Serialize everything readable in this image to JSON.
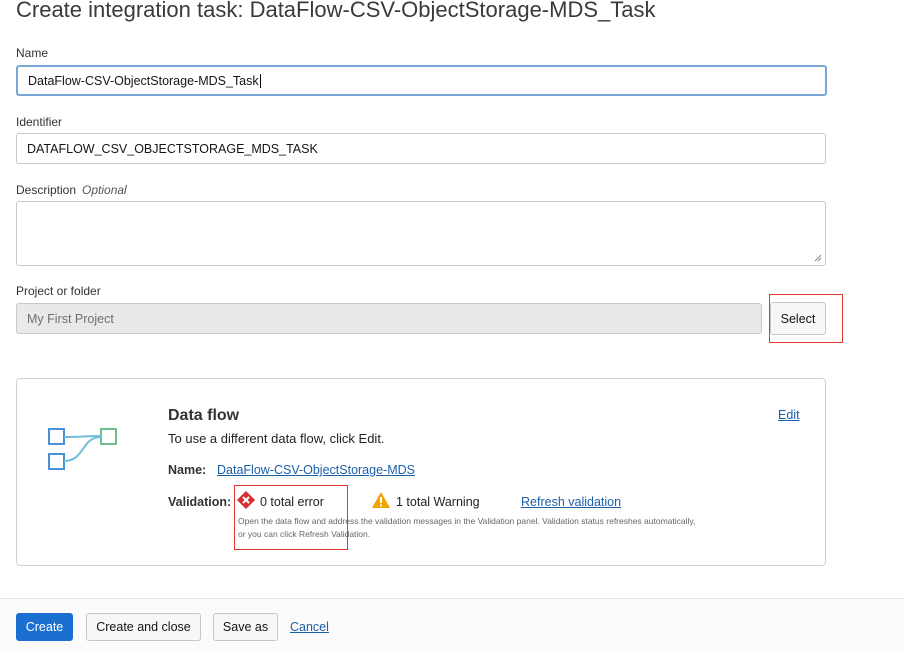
{
  "page": {
    "title": "Create integration task: DataFlow-CSV-ObjectStorage-MDS_Task"
  },
  "form": {
    "name_label": "Name",
    "name_value": "DataFlow-CSV-ObjectStorage-MDS_Task",
    "identifier_label": "Identifier",
    "identifier_value": "DATAFLOW_CSV_OBJECTSTORAGE_MDS_TASK",
    "description_label": "Description",
    "description_optional": "Optional",
    "description_value": "",
    "project_label": "Project or folder",
    "project_value": "My First Project",
    "select_label": "Select"
  },
  "dataflow": {
    "heading": "Data flow",
    "subtitle": "To use a different data flow, click Edit.",
    "edit_label": "Edit",
    "name_label": "Name:",
    "name_link": "DataFlow-CSV-ObjectStorage-MDS",
    "validation_label": "Validation:",
    "errors_text": "0 total error",
    "warnings_text": "1 total Warning",
    "refresh_label": "Refresh validation",
    "help_line1": "Open the data flow and address the validation messages in the Validation panel. Validation status refreshes automatically,",
    "help_line2": "or you can click Refresh Validation."
  },
  "footer": {
    "create_label": "Create",
    "create_close_label": "Create and close",
    "save_as_label": "Save as",
    "cancel_label": "Cancel"
  },
  "colors": {
    "primary": "#1a6fd1",
    "link": "#1a5fa8",
    "error": "#d32f2f",
    "warning": "#f0a500",
    "highlight": "#e03c31"
  }
}
